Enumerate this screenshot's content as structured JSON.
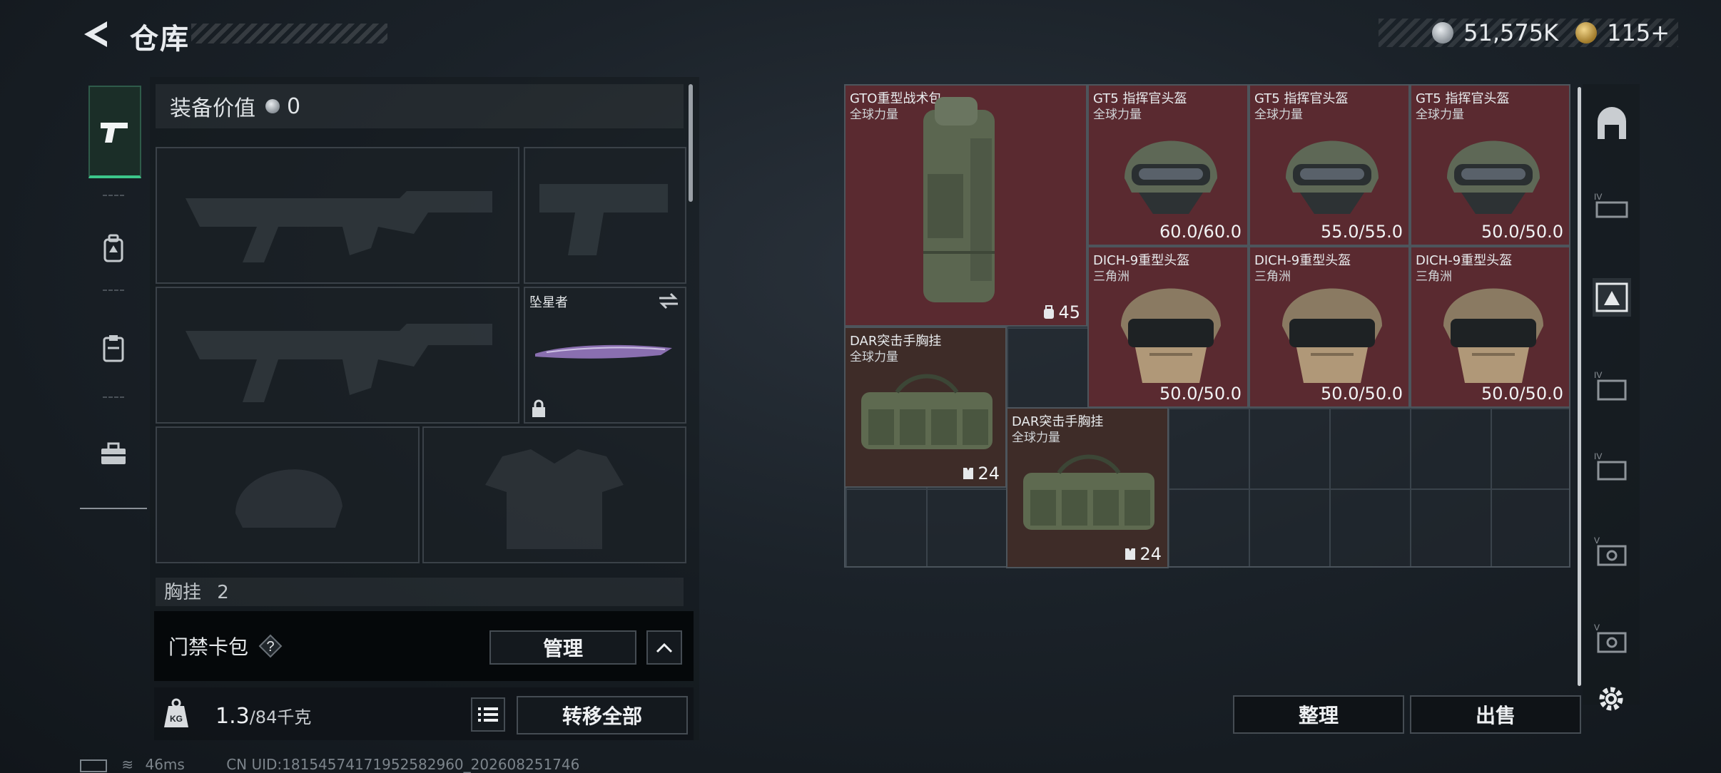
{
  "header": {
    "title": "仓库",
    "currency": [
      {
        "icon": "silver-coin-icon",
        "value": "51,575K"
      },
      {
        "icon": "gold-coin-icon",
        "value": "115+"
      }
    ]
  },
  "side_tabs": [
    {
      "icon": "pistol-icon",
      "active": true
    },
    {
      "icon": "backpack-icon",
      "active": false
    },
    {
      "icon": "clipboard-icon",
      "active": false
    },
    {
      "icon": "toolbox-icon",
      "active": false
    }
  ],
  "equipment": {
    "value_label": "装备价值",
    "value": "0",
    "melee_name": "坠星者",
    "chest_label": "胸挂",
    "chest_count": "2"
  },
  "keycard": {
    "label": "门禁卡包",
    "help": "?",
    "manage": "管理"
  },
  "weight": {
    "current": "1.3",
    "max": "/84千克",
    "transfer_all": "转移全部"
  },
  "stash_items": [
    {
      "name": "GTO重型战术包",
      "sub": "全球力量",
      "value": "45",
      "kind": "backpack",
      "bg": "red"
    },
    {
      "name": "GT5 指挥官头盔",
      "sub": "全球力量",
      "value": "60.0/60.0",
      "kind": "helmet",
      "bg": "red"
    },
    {
      "name": "GT5 指挥官头盔",
      "sub": "全球力量",
      "value": "55.0/55.0",
      "kind": "helmet",
      "bg": "red"
    },
    {
      "name": "GT5 指挥官头盔",
      "sub": "全球力量",
      "value": "50.0/50.0",
      "kind": "helmet",
      "bg": "red"
    },
    {
      "name": "DICH-9重型头盔",
      "sub": "三角洲",
      "value": "50.0/50.0",
      "kind": "dich",
      "bg": "red"
    },
    {
      "name": "DICH-9重型头盔",
      "sub": "三角洲",
      "value": "50.0/50.0",
      "kind": "dich",
      "bg": "red"
    },
    {
      "name": "DICH-9重型头盔",
      "sub": "三角洲",
      "value": "50.0/50.0",
      "kind": "dich",
      "bg": "red"
    },
    {
      "name": "DAR突击手胸挂",
      "sub": "全球力量",
      "value": "24",
      "kind": "rig",
      "bg": "brown"
    },
    {
      "name": "DAR突击手胸挂",
      "sub": "全球力量",
      "value": "24",
      "kind": "rig",
      "bg": "brown"
    }
  ],
  "actions": {
    "sort": "整理",
    "sell": "出售"
  },
  "status": {
    "ping": "46ms",
    "uid": "CN UID:18154574171952582960_202608251746"
  }
}
